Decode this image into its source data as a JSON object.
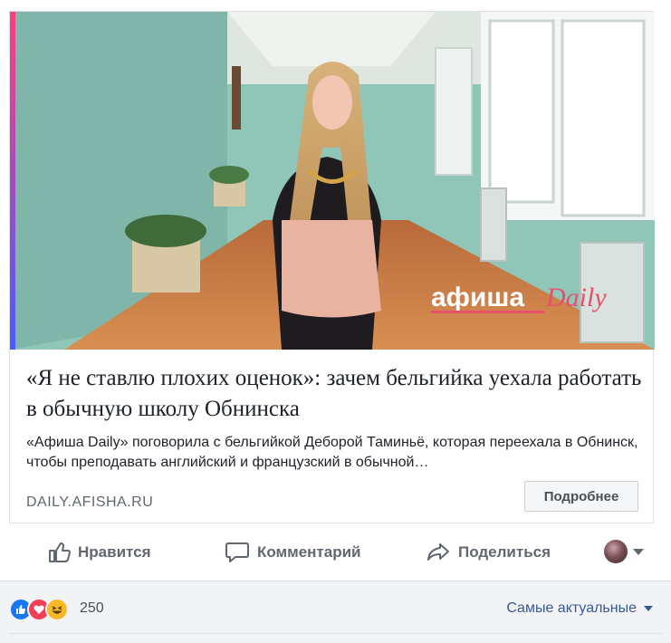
{
  "post": {
    "headline": "«Я не ставлю плохих оценок»: зачем бельгийка уехала работать в обычную школу Обнинска",
    "description": "«Афиша Daily» поговорила с бельгийкой Деборой Таминьё, которая переехала в Обнинск, чтобы преподавать английский и французский в обычной…",
    "domain": "DAILY.AFISHA.RU",
    "more_button": "Подробнее",
    "image_logo_text": "афишаDaily"
  },
  "actions": {
    "like": "Нравится",
    "comment": "Комментарий",
    "share": "Поделиться"
  },
  "reactions": {
    "count": "250",
    "icons": [
      "like-icon",
      "love-icon",
      "haha-icon"
    ]
  },
  "sort": {
    "label": "Самые актуальные"
  },
  "colors": {
    "link": "#385898",
    "like": "#1877f2",
    "love": "#f33e58",
    "haha": "#f7b928",
    "afisha_accent": "#e8506a"
  }
}
